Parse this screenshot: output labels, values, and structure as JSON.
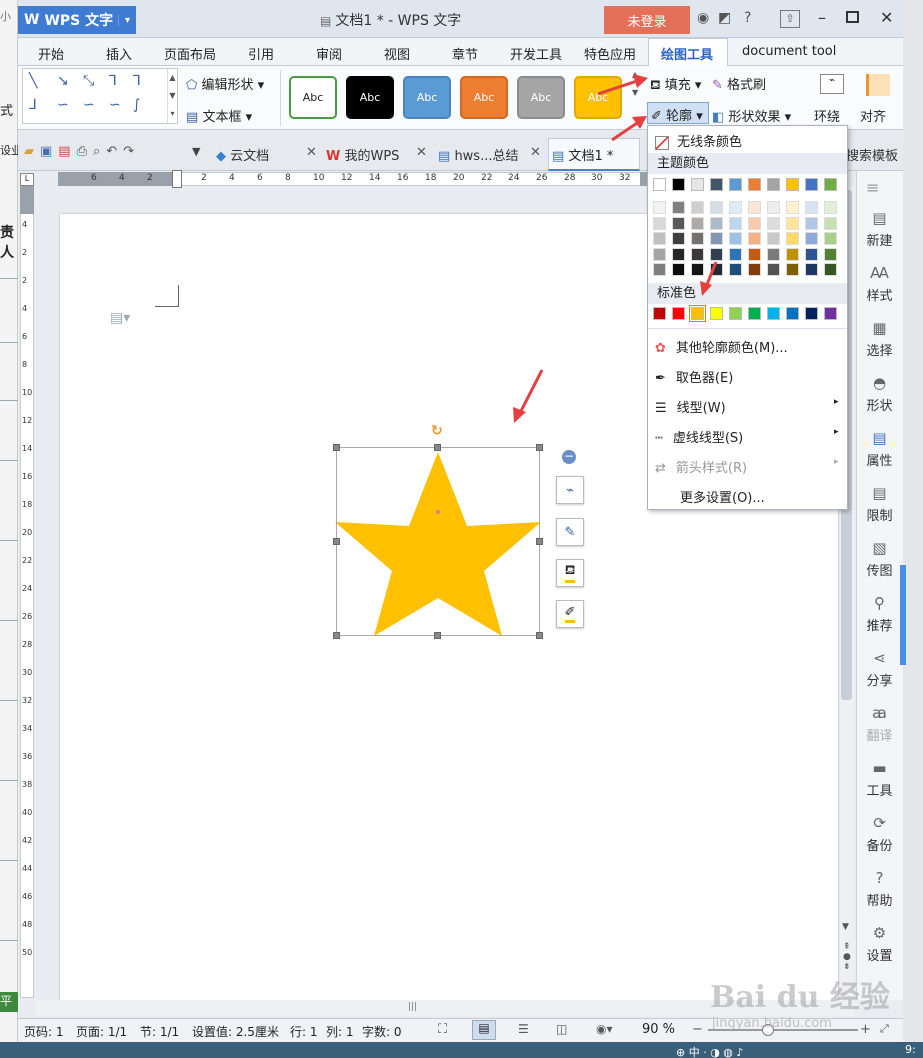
{
  "titlebar": {
    "app_label": "WPS 文字",
    "doc_title": "文档1 * - WPS 文字",
    "login": "未登录"
  },
  "menu": {
    "items": [
      "开始",
      "插入",
      "页面布局",
      "引用",
      "审阅",
      "视图",
      "章节",
      "开发工具",
      "特色应用",
      "绘图工具",
      "document tool"
    ],
    "active": "绘图工具"
  },
  "ribbon": {
    "edit_shape": "编辑形状",
    "text_box": "文本框",
    "style_swatches": [
      {
        "label": "Abc",
        "bg": "#ffffff",
        "fg": "#222222",
        "border": "#4a9a45"
      },
      {
        "label": "Abc",
        "bg": "#000000",
        "fg": "#ffffff",
        "border": "#000000"
      },
      {
        "label": "Abc",
        "bg": "#5b9bd5",
        "fg": "#ffffff",
        "border": "#4a84bd"
      },
      {
        "label": "Abc",
        "bg": "#ed7d31",
        "fg": "#ffffff",
        "border": "#d06a22"
      },
      {
        "label": "Abc",
        "bg": "#a5a5a5",
        "fg": "#ffffff",
        "border": "#8c8c8c"
      },
      {
        "label": "Abc",
        "bg": "#ffc000",
        "fg": "#ffffff",
        "border": "#e0a800"
      }
    ],
    "fill": "填充",
    "format_brush": "格式刷",
    "outline": "轮廓",
    "shape_effect": "形状效果",
    "wrap": "环绕",
    "align": "对齐"
  },
  "tabs": {
    "items": [
      "云文档",
      "我的WPS",
      "hws...总结",
      "文档1 *"
    ],
    "search_template": "搜索模板"
  },
  "ruler": {
    "h_ticks": [
      "6",
      "4",
      "2",
      "2",
      "4",
      "6",
      "8",
      "10",
      "12",
      "14",
      "16",
      "18",
      "20",
      "22",
      "24",
      "26",
      "28",
      "30",
      "32"
    ],
    "v_ticks": [
      "4",
      "2",
      "2",
      "4",
      "6",
      "8",
      "10",
      "12",
      "14",
      "16",
      "18",
      "20",
      "22",
      "24",
      "26",
      "28",
      "30",
      "32",
      "34",
      "36",
      "38",
      "40",
      "42",
      "44",
      "46",
      "48",
      "50"
    ]
  },
  "shape": {
    "fill_color": "#ffc000",
    "type": "star-icon"
  },
  "dropdown": {
    "no_line": "无线条颜色",
    "theme_colors_header": "主题颜色",
    "theme_top": [
      "#ffffff",
      "#000000",
      "#e7e6e6",
      "#44546a",
      "#5b9bd5",
      "#ed7d31",
      "#a5a5a5",
      "#ffc000",
      "#4472c4",
      "#70ad47"
    ],
    "theme_shades": [
      [
        "#f2f2f2",
        "#808080",
        "#d0cece",
        "#d6dce4",
        "#deebf6",
        "#fbe5d5",
        "#ededed",
        "#fff2cc",
        "#dae3f3",
        "#e2efd9"
      ],
      [
        "#d8d8d8",
        "#595959",
        "#aeaaaa",
        "#adb9ca",
        "#bdd7ee",
        "#f7cbac",
        "#dbdbdb",
        "#fee599",
        "#b4c6e7",
        "#c5e0b3"
      ],
      [
        "#bfbfbf",
        "#3f3f3f",
        "#757070",
        "#8496b0",
        "#9cc3e5",
        "#f4b183",
        "#c9c9c9",
        "#ffd965",
        "#8eaadb",
        "#a8d08d"
      ],
      [
        "#a5a5a5",
        "#262626",
        "#3a3838",
        "#323f4f",
        "#2e75b5",
        "#c55a11",
        "#7b7b7b",
        "#bf9000",
        "#2f5496",
        "#538135"
      ],
      [
        "#7f7f7f",
        "#0c0c0c",
        "#171616",
        "#222a35",
        "#1e4e79",
        "#833c0b",
        "#525252",
        "#7f6000",
        "#1f3864",
        "#375623"
      ]
    ],
    "standard_header": "标准色",
    "standard_colors": [
      "#c00000",
      "#ff0000",
      "#ffc000",
      "#ffff00",
      "#92d050",
      "#00b050",
      "#00b0f0",
      "#0070c0",
      "#002060",
      "#7030a0"
    ],
    "more_colors": "其他轮廓颜色(M)...",
    "eyedropper": "取色器(E)",
    "line_type": "线型(W)",
    "dash_type": "虚线线型(S)",
    "arrow_style": "箭头样式(R)",
    "more_settings": "更多设置(O)..."
  },
  "sidebar": {
    "items": [
      "新建",
      "样式",
      "选择",
      "形状",
      "属性",
      "限制",
      "传图",
      "推荐",
      "分享",
      "翻译",
      "工具",
      "备份",
      "帮助",
      "设置"
    ]
  },
  "status": {
    "page": "页码: 1",
    "pages": "页面: 1/1",
    "section": "节: 1/1",
    "setting": "设置值: 2.5厘米",
    "row": "行: 1",
    "col": "列: 1",
    "chars": "字数: 0",
    "zoom": "90 %"
  },
  "left_strip": {
    "top": "小",
    "style": "式",
    "biz": "设业",
    "resp": "责",
    "person": "人",
    "flat": "平"
  },
  "watermark": {
    "brand": "Bai du 经验",
    "url": "jingyan.baidu.com"
  },
  "accent": "#e54040"
}
